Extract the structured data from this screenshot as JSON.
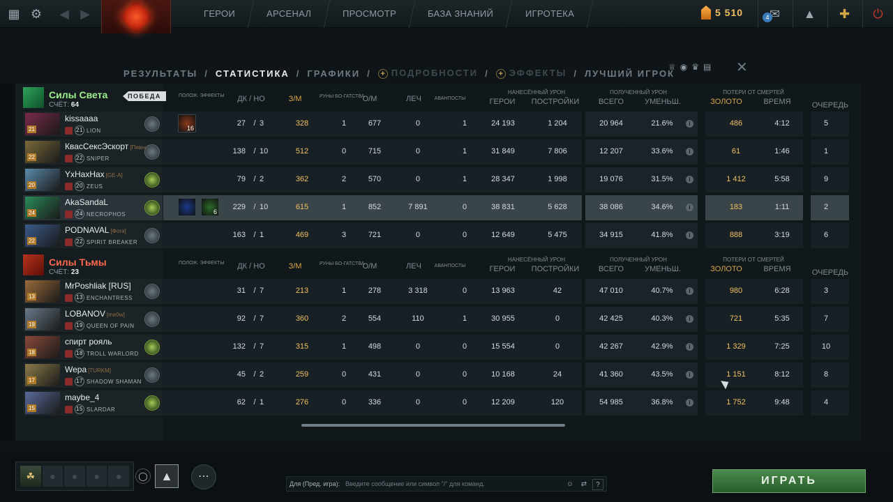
{
  "topbar": {
    "nav": [
      "ГЕРОИ",
      "АРСЕНАЛ",
      "ПРОСМОТР",
      "БАЗА ЗНАНИЙ",
      "ИГРОТЕКА"
    ],
    "gold": "5 510",
    "notification_count": "4"
  },
  "tabs": {
    "results": "РЕЗУЛЬТАТЫ",
    "stats": "СТАТИСТИКА",
    "graphs": "ГРАФИКИ",
    "details": "ПОДРОБНОСТИ",
    "effects": "ЭФФЕКТЫ",
    "best": "ЛУЧШИЙ ИГРОК",
    "sep": "/"
  },
  "headers": {
    "buffs": "ПОЛОЖ. ЭФФЕКТЫ",
    "kd": "ДК / НО",
    "gpm": "З/М",
    "runes": "РУНЫ БО-ГАТСТВА",
    "xpm": "О/М",
    "heal": "ЛЕЧ",
    "buyback": "АВАНПОСТЫ",
    "dmg_dealt": "НАНЕСЁННЫЙ УРОН",
    "heroes": "ГЕРОИ",
    "buildings": "ПОСТРОЙКИ",
    "dmg_taken": "ПОЛУЧЕННЫЙ УРОН",
    "total": "ВСЕГО",
    "reduced": "УМЕНЬШ.",
    "death_loss": "ПОТЕРИ ОТ СМЕРТЕЙ",
    "gold": "ЗОЛОТО",
    "time": "ВРЕМЯ",
    "queue": "ОЧЕРЕДЬ"
  },
  "radiant": {
    "name": "Силы Света",
    "score_label": "СЧЁТ:",
    "score": "64",
    "victory": "ПОБЕДА",
    "players": [
      {
        "name": "kissaaaa",
        "tag": "",
        "level": "21",
        "hero": "LION",
        "portrait_color": "#7a2a4a",
        "rank": "grey",
        "kills": "27",
        "deaths": "3",
        "gpm": "328",
        "runes": "1",
        "xpm": "677",
        "heal": "0",
        "outposts": "1",
        "hero_dmg": "24 193",
        "bld_dmg": "1 204",
        "taken": "20 964",
        "reduced": "21.6%",
        "lost_gold": "486",
        "lost_time": "4:12",
        "queue": "5",
        "buffs": [
          {
            "icon": "fire-buff-icon",
            "color": "#8a3a1a",
            "count": "16"
          }
        ]
      },
      {
        "name": "КвасСексЭскорт",
        "tag": "[Пивни]",
        "level": "22",
        "hero": "SNIPER",
        "portrait_color": "#7a6a3a",
        "rank": "grey",
        "kills": "138",
        "deaths": "10",
        "gpm": "512",
        "runes": "0",
        "xpm": "715",
        "heal": "0",
        "outposts": "1",
        "hero_dmg": "31 849",
        "bld_dmg": "7 806",
        "taken": "12 207",
        "reduced": "33.6%",
        "lost_gold": "61",
        "lost_time": "1:46",
        "queue": "1",
        "buffs": []
      },
      {
        "name": "YxHaxHax",
        "tag": "[GE-A]",
        "level": "20",
        "hero": "ZEUS",
        "portrait_color": "#5a8aa8",
        "rank": "green",
        "kills": "79",
        "deaths": "2",
        "gpm": "362",
        "runes": "2",
        "xpm": "570",
        "heal": "0",
        "outposts": "1",
        "hero_dmg": "28 347",
        "bld_dmg": "1 998",
        "taken": "19 076",
        "reduced": "31.5%",
        "lost_gold": "1 412",
        "lost_time": "5:58",
        "queue": "9",
        "buffs": []
      },
      {
        "name": "AkaSandaL",
        "tag": "",
        "level": "24",
        "hero": "NECROPHOS",
        "portrait_color": "#2a8a5a",
        "rank": "green",
        "kills": "229",
        "deaths": "10",
        "gpm": "615",
        "runes": "1",
        "xpm": "852",
        "heal": "7 891",
        "outposts": "0",
        "hero_dmg": "38 831",
        "bld_dmg": "5 628",
        "taken": "38 086",
        "reduced": "34.6%",
        "lost_gold": "183",
        "lost_time": "1:11",
        "queue": "2",
        "buffs": [
          {
            "icon": "magic-buff-icon",
            "color": "#1a3a8a",
            "count": ""
          },
          {
            "icon": "nature-buff-icon",
            "color": "#2a6a2a",
            "count": "6"
          }
        ]
      },
      {
        "name": "PODNAVAL",
        "tag": "[Фога]",
        "level": "22",
        "hero": "SPIRIT BREAKER",
        "portrait_color": "#3a5a8a",
        "rank": "grey",
        "kills": "163",
        "deaths": "1",
        "gpm": "469",
        "runes": "3",
        "xpm": "721",
        "heal": "0",
        "outposts": "0",
        "hero_dmg": "12 649",
        "bld_dmg": "5 475",
        "taken": "34 915",
        "reduced": "41.8%",
        "lost_gold": "888",
        "lost_time": "3:19",
        "queue": "6",
        "buffs": []
      }
    ]
  },
  "dire": {
    "name": "Силы Тьмы",
    "score_label": "СЧЁТ:",
    "score": "23",
    "players": [
      {
        "name": "MrPoshliak [RUS]",
        "tag": "",
        "level": "13",
        "hero": "ENCHANTRESS",
        "portrait_color": "#9a6a3a",
        "rank": "grey",
        "kills": "31",
        "deaths": "7",
        "gpm": "213",
        "runes": "1",
        "xpm": "278",
        "heal": "3 318",
        "outposts": "0",
        "hero_dmg": "13 963",
        "bld_dmg": "42",
        "taken": "47 010",
        "reduced": "40.7%",
        "lost_gold": "980",
        "lost_time": "6:28",
        "queue": "3"
      },
      {
        "name": "LOBANOV",
        "tag": "[me0w]",
        "level": "19",
        "hero": "QUEEN OF PAIN",
        "portrait_color": "#6a7a8a",
        "rank": "grey",
        "kills": "92",
        "deaths": "7",
        "gpm": "360",
        "runes": "2",
        "xpm": "554",
        "heal": "110",
        "outposts": "1",
        "hero_dmg": "30 955",
        "bld_dmg": "0",
        "taken": "42 425",
        "reduced": "40.3%",
        "lost_gold": "721",
        "lost_time": "5:35",
        "queue": "7"
      },
      {
        "name": "спирт рояль",
        "tag": "",
        "level": "18",
        "hero": "TROLL WARLORD",
        "portrait_color": "#8a4a3a",
        "rank": "green",
        "kills": "132",
        "deaths": "7",
        "gpm": "315",
        "runes": "1",
        "xpm": "498",
        "heal": "0",
        "outposts": "0",
        "hero_dmg": "15 554",
        "bld_dmg": "0",
        "taken": "42 267",
        "reduced": "42.9%",
        "lost_gold": "1 329",
        "lost_time": "7:25",
        "queue": "10"
      },
      {
        "name": "Wepa",
        "tag": "[TURKM]",
        "level": "17",
        "hero": "SHADOW SHAMAN",
        "portrait_color": "#8a7a4a",
        "rank": "grey",
        "kills": "45",
        "deaths": "2",
        "gpm": "259",
        "runes": "0",
        "xpm": "431",
        "heal": "0",
        "outposts": "0",
        "hero_dmg": "10 168",
        "bld_dmg": "24",
        "taken": "41 360",
        "reduced": "43.5%",
        "lost_gold": "1 151",
        "lost_time": "8:12",
        "queue": "8"
      },
      {
        "name": "maybe_4",
        "tag": "",
        "level": "15",
        "hero": "SLARDAR",
        "portrait_color": "#5a6a9a",
        "rank": "green",
        "kills": "62",
        "deaths": "1",
        "gpm": "276",
        "runes": "0",
        "xpm": "336",
        "heal": "0",
        "outposts": "0",
        "hero_dmg": "12 209",
        "bld_dmg": "120",
        "taken": "54 985",
        "reduced": "36.8%",
        "lost_gold": "1 752",
        "lost_time": "9:48",
        "queue": "4"
      }
    ]
  },
  "bottom": {
    "chat_label": "Для (Пред. игра):",
    "chat_placeholder": "Введите сообщение или символ \"/\" для команд.",
    "help": "?",
    "play": "ИГРАТЬ"
  },
  "colors": {
    "radiant": "#9ef08c",
    "dire": "#ff6a4a",
    "gold": "#f0c060",
    "play_button": "#3a7a3e"
  }
}
